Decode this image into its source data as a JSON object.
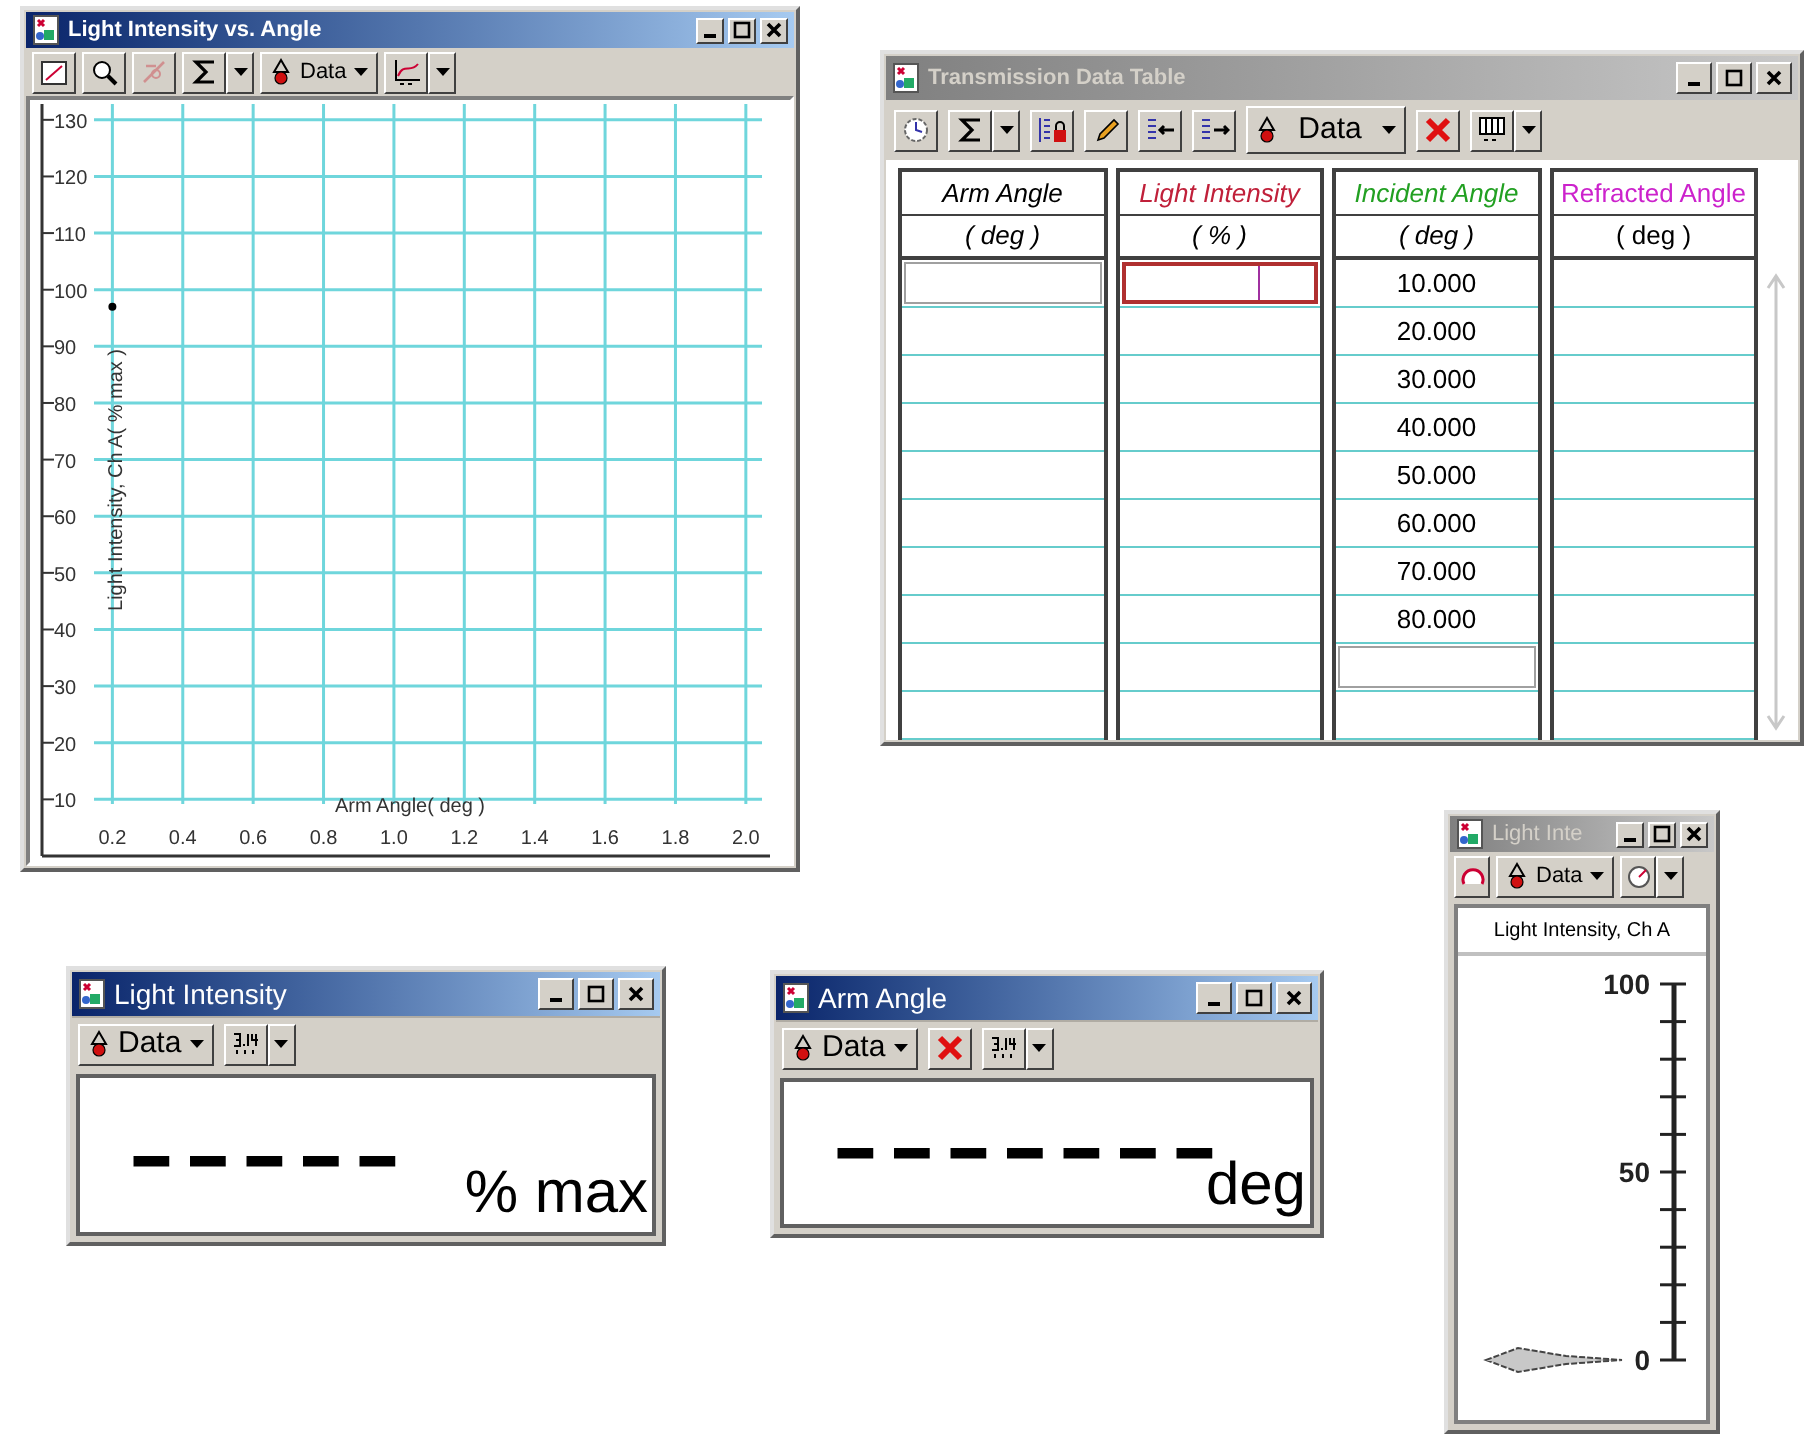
{
  "graph_window": {
    "title": "Light Intensity vs. Angle",
    "active": true,
    "data_button": "Data",
    "chart_data": {
      "type": "scatter",
      "grid": true,
      "xlabel": "Arm Angle( deg )",
      "ylabel": "Light Intensity, Ch A( % max )",
      "x": [
        0.2
      ],
      "values": [
        97
      ],
      "xlim": [
        0,
        2.08
      ],
      "ylim": [
        0,
        133.5
      ],
      "xticks": [
        {
          "value": 0.2,
          "label": "0.2"
        },
        {
          "value": 0.4,
          "label": "0.4"
        },
        {
          "value": 0.6,
          "label": "0.6"
        },
        {
          "value": 0.8,
          "label": "0.8"
        },
        {
          "value": 1,
          "label": "1.0"
        },
        {
          "value": 1.2,
          "label": "1.2"
        },
        {
          "value": 1.4,
          "label": "1.4"
        },
        {
          "value": 1.6,
          "label": "1.6"
        },
        {
          "value": 1.8,
          "label": "1.8"
        },
        {
          "value": 2,
          "label": "2.0"
        }
      ],
      "yticks": [
        10,
        20,
        30,
        40,
        50,
        60,
        70,
        80,
        90,
        100,
        110,
        120,
        130
      ]
    }
  },
  "table_window": {
    "title": "Transmission Data Table",
    "active": false,
    "data_button": "Data",
    "columns": [
      {
        "name": "Arm Angle",
        "unit": "( deg )",
        "color": "#000000",
        "italic": true,
        "entry_box": true,
        "editing": false
      },
      {
        "name": "Light Intensity",
        "unit": "( % )",
        "color": "#c0203a",
        "italic": true,
        "entry_box": true,
        "editing": true
      },
      {
        "name": "Incident Angle",
        "unit": "( deg )",
        "color": "#22a022",
        "italic": true,
        "entry_box": true,
        "editing": false,
        "values": [
          "10.000",
          "20.000",
          "30.000",
          "40.000",
          "50.000",
          "60.000",
          "70.000",
          "80.000"
        ]
      },
      {
        "name": "Refracted Angle",
        "unit": "( deg )",
        "color": "#cc22cc",
        "italic": false,
        "entry_box": false
      }
    ]
  },
  "meter_window": {
    "title": "Light Inte",
    "active": false,
    "data_button": "Data",
    "caption": "Light Intensity, Ch A",
    "scale": [
      "100",
      "50",
      "0"
    ]
  },
  "light_intensity_window": {
    "title": "Light Intensity",
    "active": true,
    "data_button": "Data",
    "delete_button": false,
    "reading": "-----",
    "unit": "% max"
  },
  "arm_angle_window": {
    "title": "Arm Angle",
    "active": true,
    "data_button": "Data",
    "delete_button": true,
    "reading": "-------",
    "unit": "deg"
  }
}
